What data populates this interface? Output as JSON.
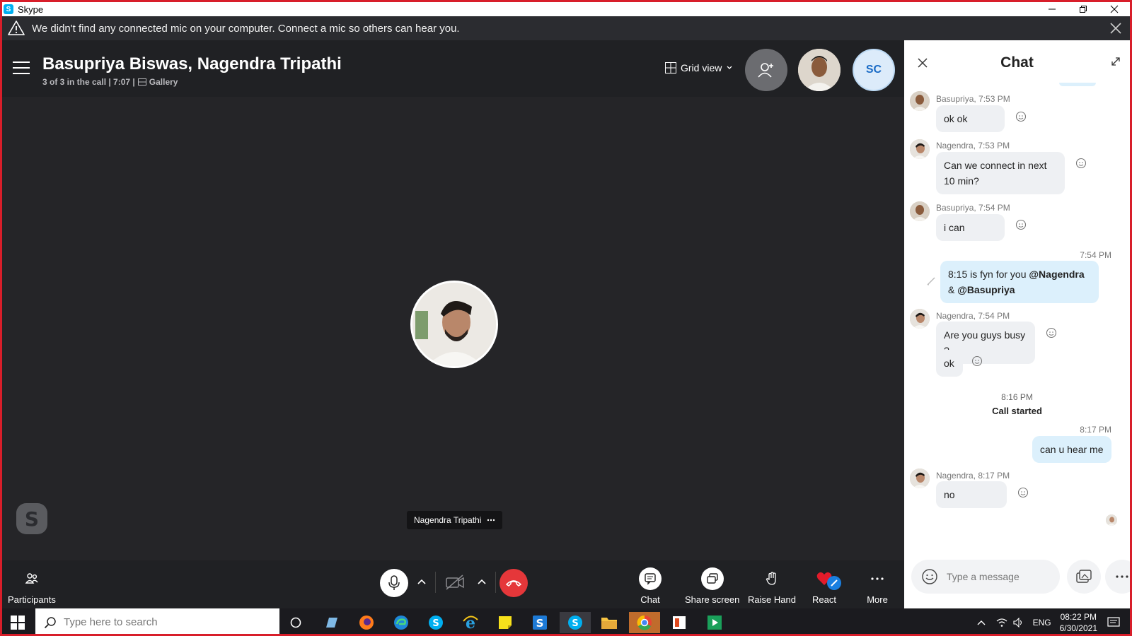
{
  "window": {
    "title": "Skype"
  },
  "warning": {
    "text": "We didn't find any connected mic on your computer. Connect a mic so others can hear you."
  },
  "call": {
    "title": "Basupriya Biswas, Nagendra Tripathi",
    "participants_count": "3 of 3 in the call | 7:07 |",
    "layout_label": "Gallery",
    "view_label": "Grid view",
    "sc_initials": "SC",
    "speaker_name": "Nagendra Tripathi"
  },
  "controls": {
    "participants": "Participants",
    "chat": "Chat",
    "share_screen": "Share screen",
    "raise_hand": "Raise Hand",
    "react": "React",
    "more": "More"
  },
  "chat": {
    "title": "Chat",
    "input_placeholder": "Type a message",
    "messages": [
      {
        "meta": "Basupriya, 7:53 PM",
        "text": "ok ok"
      },
      {
        "meta": "Nagendra, 7:53 PM",
        "text": "Can we connect in next 10 min?"
      },
      {
        "meta": "Basupriya, 7:54 PM",
        "text": "i can"
      },
      {
        "meta": "7:54 PM",
        "text_plain": "8:15 is fyn  for you ",
        "mention1": "@Nagendra",
        "amp": " & ",
        "mention2": "@Basupriya"
      },
      {
        "meta": "Nagendra, 7:54 PM",
        "text": "Are you guys busy ?"
      },
      {
        "text": "ok"
      },
      {
        "meta": "8:16 PM",
        "text": "Call started"
      },
      {
        "meta": "8:17 PM",
        "text": "can u hear me"
      },
      {
        "meta": "Nagendra, 8:17 PM",
        "text": "no"
      }
    ]
  },
  "taskbar": {
    "search_placeholder": "Type here to search",
    "lang": "ENG",
    "time": "08:22 PM",
    "date": "6/30/2021"
  },
  "colors": {
    "accent": "#00aff0",
    "end_call": "#e5373a",
    "border": "#d81e2a",
    "my_bubble": "#dcf0fc"
  }
}
